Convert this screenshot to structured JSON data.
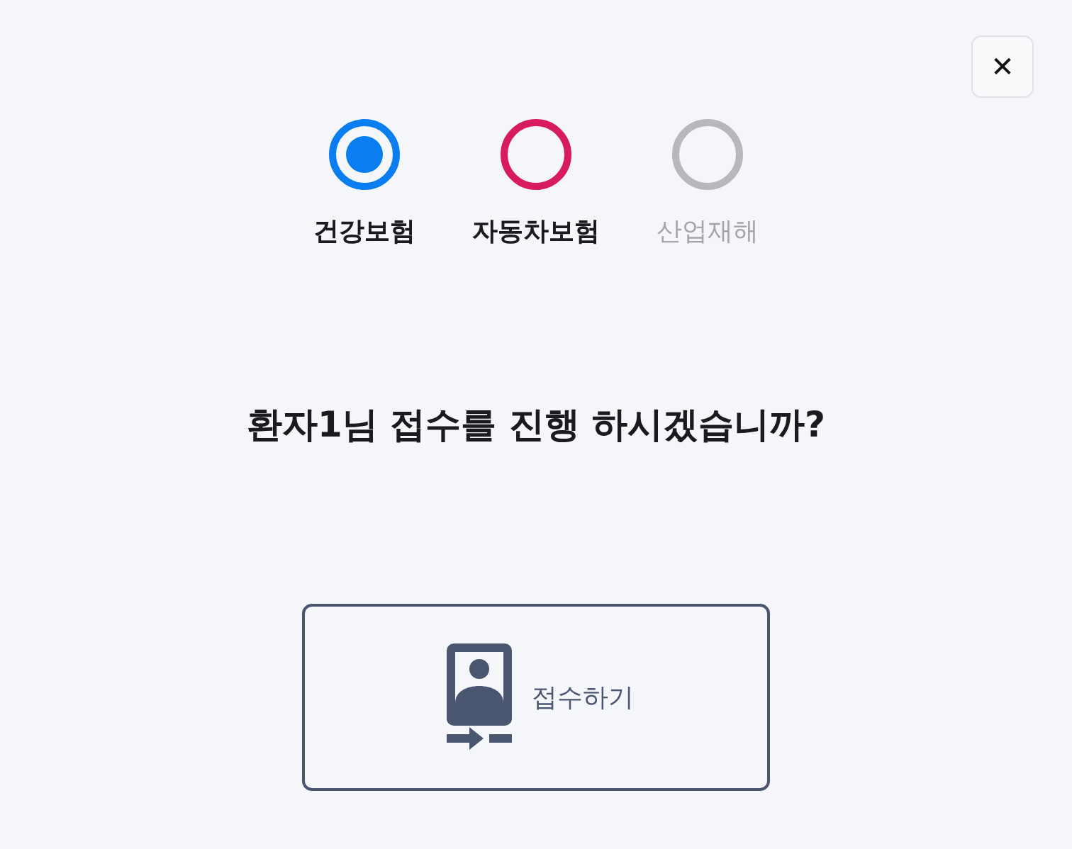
{
  "close_button": {
    "label": "✕"
  },
  "insurance_options": [
    {
      "label": "건강보험",
      "selected": true,
      "disabled": false,
      "color": "#0a7ef0"
    },
    {
      "label": "자동차보험",
      "selected": false,
      "disabled": false,
      "color": "#d81b5e"
    },
    {
      "label": "산업재해",
      "selected": false,
      "disabled": true,
      "color": "#b8b8bc"
    }
  ],
  "question": "환자1님 접수를 진행 하시겠습니까?",
  "submit_button": {
    "label": "접수하기"
  }
}
